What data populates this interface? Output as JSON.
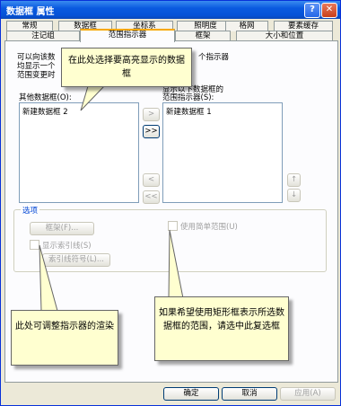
{
  "window": {
    "title": "数据框 属性",
    "help": "?",
    "close": "✕"
  },
  "tabs": {
    "row1": [
      "常规",
      "数据框",
      "坐标系",
      "照明度",
      "格网",
      "要素缓存"
    ],
    "row2": [
      "注记组",
      "范围指示器",
      "框架",
      "大小和位置"
    ]
  },
  "panel": {
    "intro_lines": [
      "可以向该数",
      "均显示一个",
      "范围变更时"
    ],
    "intro_right": "个指示器",
    "other_frames_label": "其他数据框(O):",
    "other_frames_items": [
      "新建数据框 2"
    ],
    "right_label_line1": "显示以下数据框的",
    "right_label_line2": "范围指示器(S):",
    "indicator_items": [
      "新建数据框 1"
    ],
    "move_buttons": [
      ">",
      ">>",
      "<",
      "<<"
    ],
    "order_buttons": [
      "↑",
      "↓"
    ],
    "options_group": "选项",
    "frame_button": "框架(F)...",
    "leader_checkbox": "显示索引线(S)",
    "leader_symbol_button": "索引线符号(L)...",
    "simple_extent_checkbox": "使用简单范围(U)"
  },
  "callouts": {
    "top": "在此处选择要高亮显示的数据框",
    "left": "此处可调整指示器的渲染",
    "right": "如果希望使用矩形框表示所选数据框的范围，请选中此复选框"
  },
  "footer": {
    "ok": "确定",
    "cancel": "取消",
    "apply": "应用(A)"
  }
}
